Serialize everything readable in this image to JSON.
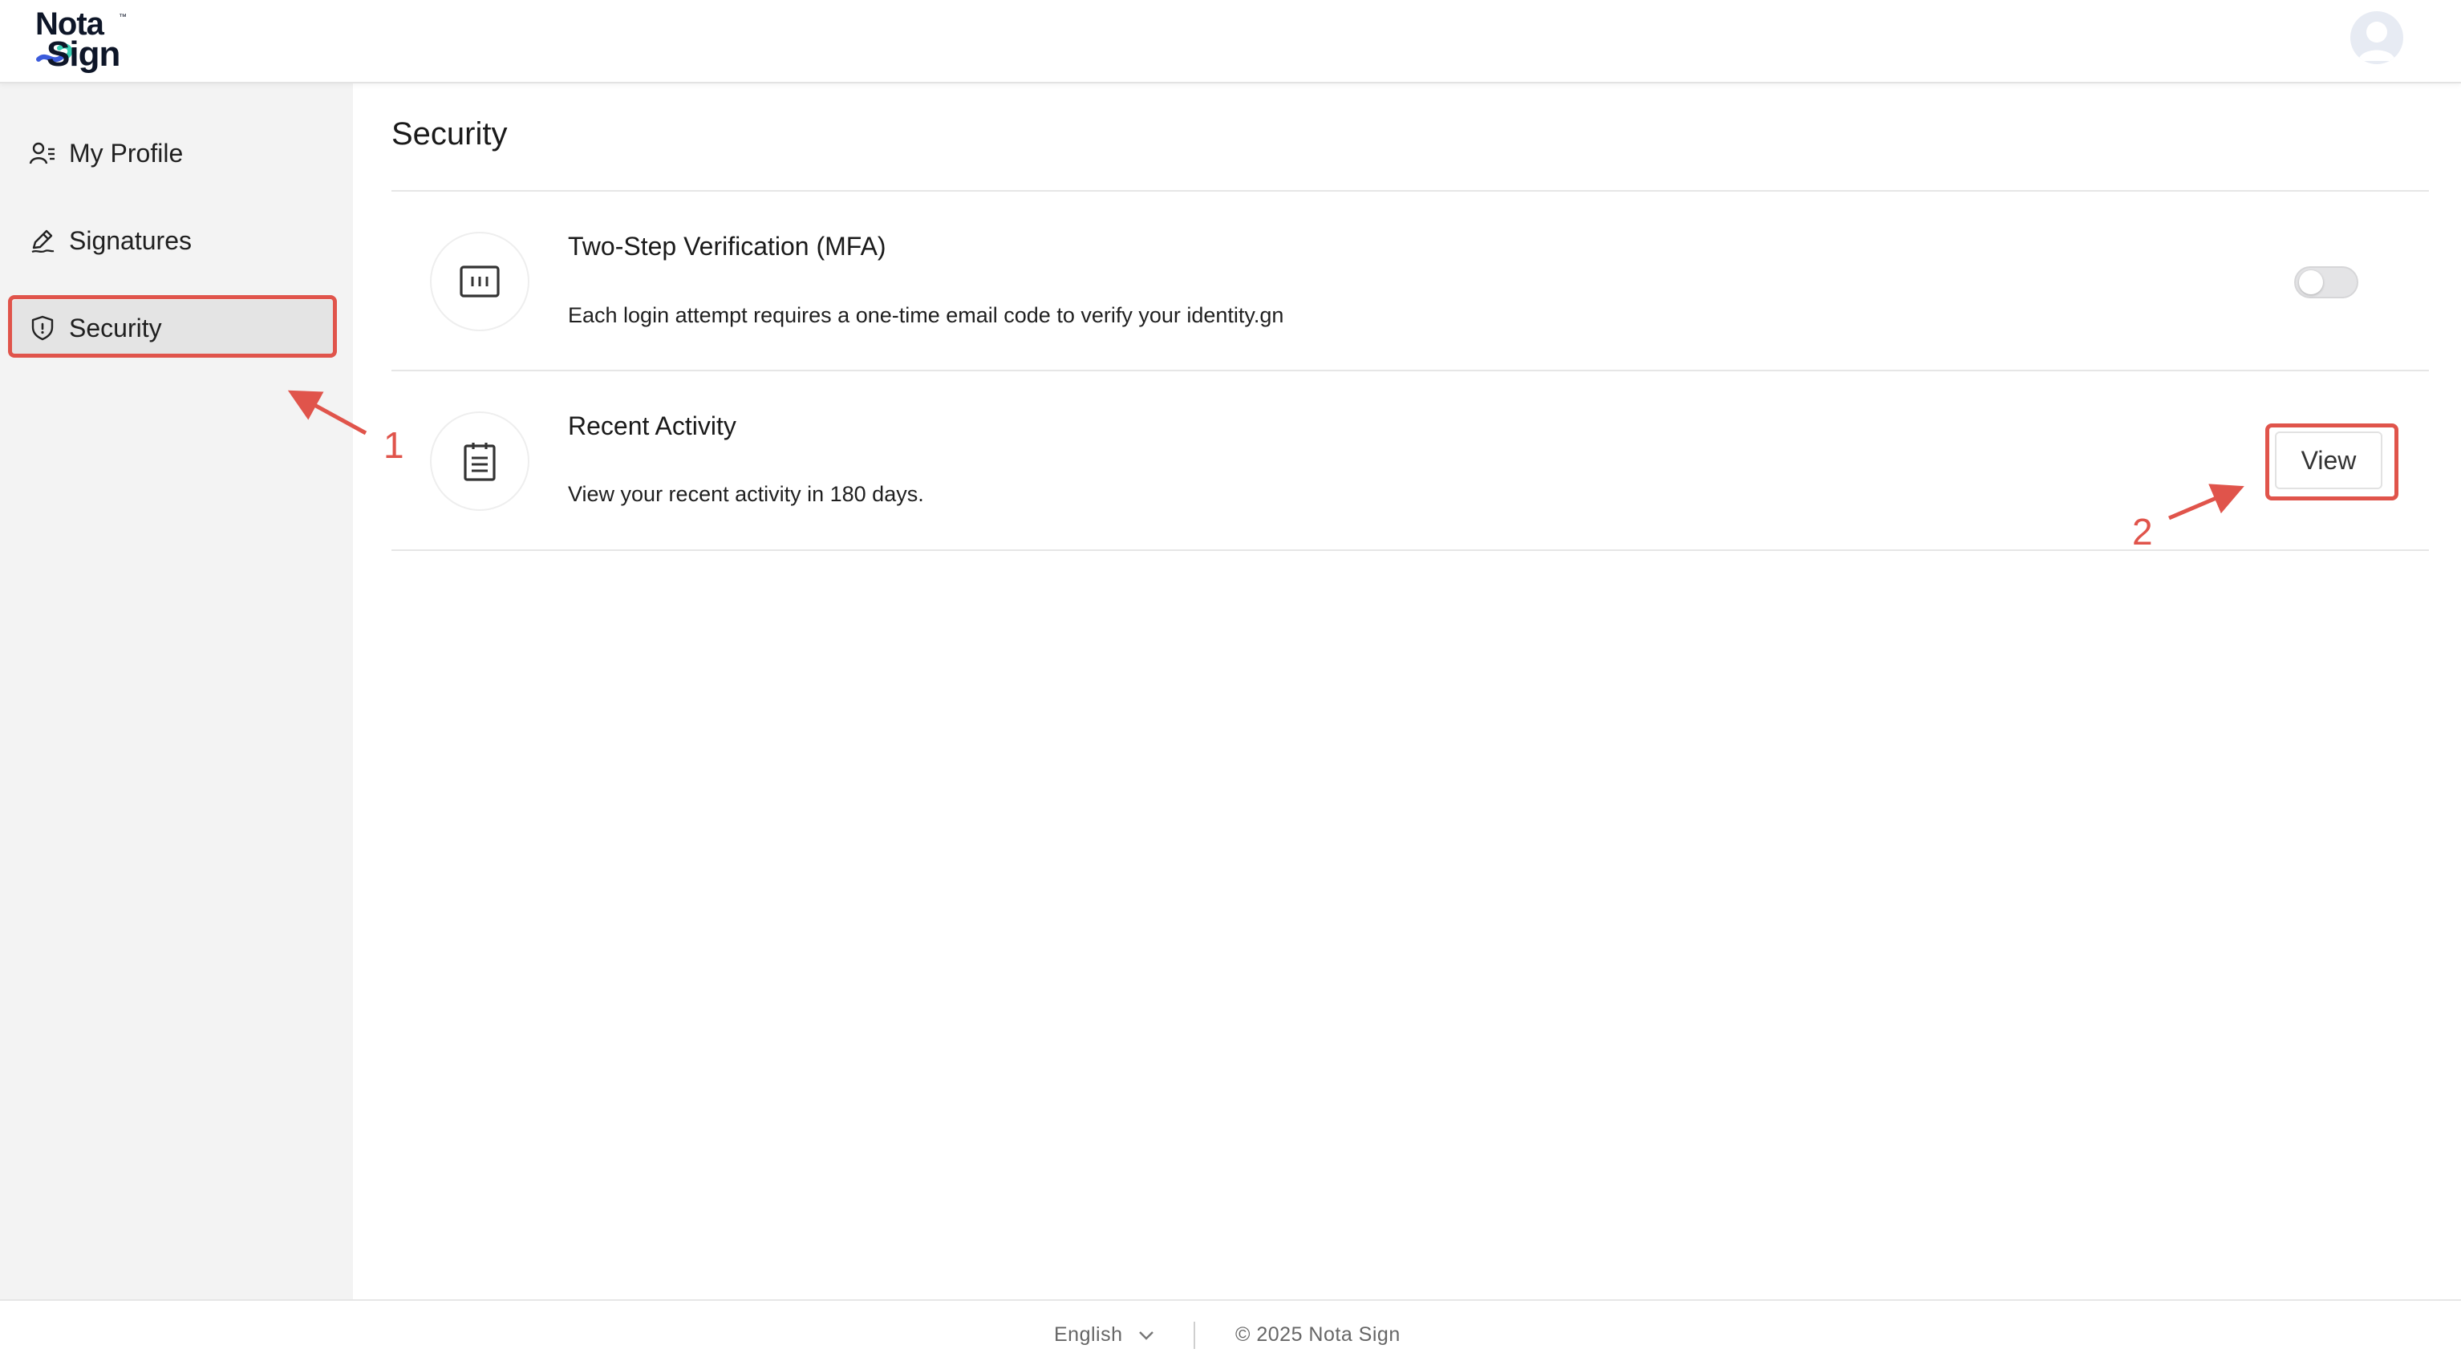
{
  "app": {
    "logo_line1": "Nota",
    "logo_line2": "Sign",
    "logo_tm": "™"
  },
  "sidebar": {
    "items": [
      {
        "label": "My Profile",
        "icon": "user-list-icon"
      },
      {
        "label": "Signatures",
        "icon": "pen-icon"
      },
      {
        "label": "Security",
        "icon": "shield-icon",
        "active": true
      }
    ]
  },
  "main": {
    "title": "Security",
    "rows": [
      {
        "title": "Two-Step Verification (MFA)",
        "description": "Each login attempt requires a one-time email code to verify your identity.gn",
        "icon": "otp-code-icon",
        "control": "toggle",
        "enabled": false
      },
      {
        "title": "Recent Activity",
        "description": "View your recent activity in 180 days.",
        "icon": "clipboard-icon",
        "control": "button",
        "button_label": "View"
      }
    ]
  },
  "annotations": {
    "step1": "1",
    "step2": "2",
    "color": "#e0544b"
  },
  "footer": {
    "language": "English",
    "copyright": "© 2025 Nota Sign"
  },
  "colors": {
    "sidebar_bg": "#f3f3f3",
    "active_item_bg": "#e4e4e4",
    "brand_dark": "#0e1628",
    "brand_blue": "#3b5bdb",
    "brand_teal": "#3ad1b5"
  }
}
